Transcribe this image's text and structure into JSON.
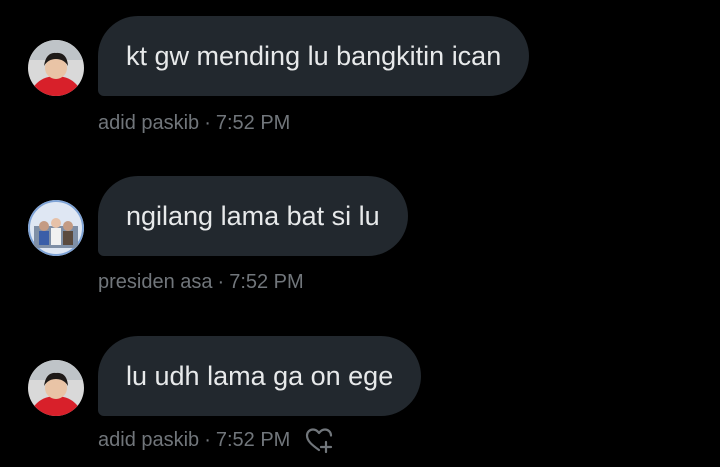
{
  "messages": [
    {
      "text": "kt gw mending lu bangkitin ican",
      "sender": "adid paskib",
      "separator": "·",
      "time": "7:52 PM",
      "avatar_icon": "user-avatar-red-shirt"
    },
    {
      "text": "ngilang lama bat si lu",
      "sender": "presiden asa",
      "separator": "·",
      "time": "7:52 PM",
      "avatar_icon": "user-avatar-group-photo"
    },
    {
      "text": "lu udh lama ga on ege",
      "sender": "adid paskib",
      "separator": "·",
      "time": "7:52 PM",
      "avatar_icon": "user-avatar-red-shirt"
    }
  ],
  "colors": {
    "background": "#000000",
    "bubble": "#22282e",
    "message_text": "#e7e9ea",
    "meta_text": "#71767b"
  },
  "icons": {
    "add_reaction": "add-reaction-heart-icon"
  }
}
